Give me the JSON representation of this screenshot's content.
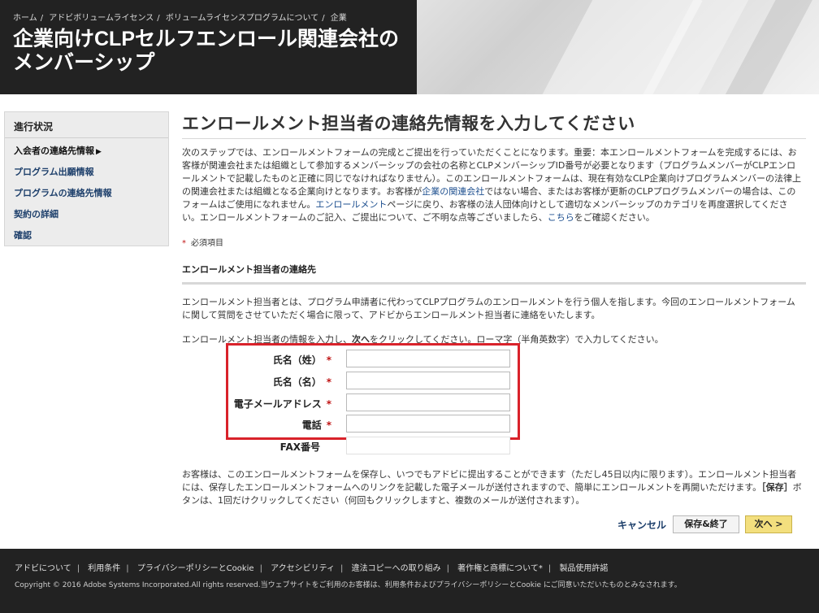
{
  "header": {
    "breadcrumb": [
      "ホーム",
      "アドビボリュームライセンス",
      "ボリュームライセンスプログラムについて",
      "企業"
    ],
    "breadcrumb_separator": "/",
    "title": "企業向けCLPセルフエンロール関連会社のメンバーシップ"
  },
  "sidebar": {
    "heading": "進行状況",
    "items": [
      {
        "label": "入会者の連絡先情報",
        "active": true
      },
      {
        "label": "プログラム出願情報",
        "active": false
      },
      {
        "label": "プログラムの連絡先情報",
        "active": false
      },
      {
        "label": "契約の詳細",
        "active": false
      },
      {
        "label": "確認",
        "active": false
      }
    ],
    "active_marker": "▶"
  },
  "main": {
    "title": "エンロールメント担当者の連絡先情報を入力してください",
    "intro": {
      "p1": "次のステップでは、エンロールメントフォームの完成とご提出を行っていただくことになります。重要：本エンロールメントフォームを完成するには、お客様が関連会社または組織として参加するメンバーシップの会社の名称とCLPメンバーシップID番号が必要となります（プログラムメンバーがCLPエンロールメントで記載したものと正確に同じでなければなりません）。このエンロールメントフォームは、現在有効なCLP企業向けプログラムメンバーの法律上の関連会社または組織となる企業向けとなります。お客様が",
      "link1": "企業の関連会社",
      "p2": "ではない場合、またはお客様が更新のCLPプログラムメンバーの場合は、このフォームはご使用になれません。",
      "link2": "エンロールメント",
      "p3": "ページに戻り、お客様の法人団体向けとして適切なメンバーシップのカテゴリを再度選択してください。エンロールメントフォームのご記入、ご提出について、ご不明な点等ございましたら、",
      "link3": "こちら",
      "p4": "をご確認ください。"
    },
    "required_star": "*",
    "required_note": "必須項目",
    "section_head": "エンロールメント担当者の連絡先",
    "para1": "エンロールメント担当者とは、プログラム申請者に代わってCLPプログラムのエンロールメントを行う個人を指します。今回のエンロールメントフォームに関して質問をさせていただく場合に限って、アドビからエンロールメント担当者に連絡をいたします。",
    "para2_a": "エンロールメント担当者の情報を入力し、",
    "para2_next": "次へ",
    "para2_b": "をクリックしてください。ローマ字（半角英数字）で入力してください。"
  },
  "form": {
    "fields": [
      {
        "label": "氏名（姓）",
        "required": "*",
        "value": ""
      },
      {
        "label": "氏名（名）",
        "required": "*",
        "value": ""
      },
      {
        "label": "電子メールアドレス",
        "required": "*",
        "value": ""
      },
      {
        "label": "電話",
        "required": "*",
        "value": ""
      },
      {
        "label": "FAX番号",
        "required": "",
        "value": ""
      }
    ]
  },
  "save_note": {
    "a": "お客様は、このエンロールメントフォームを保存し、いつでもアドビに提出することができます（ただし45日以内に限ります）。エンロールメント担当者には、保存したエンロールメントフォームへのリンクを記載した電子メールが送付されますので、簡単にエンロールメントを再開いただけます。",
    "bold": "［保存］",
    "b": "ボタンは、1回だけクリックしてください（何回もクリックしますと、複数のメールが送付されます）。"
  },
  "actions": {
    "cancel": "キャンセル",
    "save": "保存&終了",
    "next": "次へ >"
  },
  "footer": {
    "links": [
      "アドビについて",
      "利用条件",
      "プライバシーポリシーとCookie",
      "アクセシビリティ",
      "違法コピーへの取り組み",
      "著作権と商標について*",
      "製品使用許諾"
    ],
    "separator": "|",
    "copyright": "Copyright © 2016 Adobe Systems Incorporated.All rights reserved.当ウェブサイトをご利用のお客様は、利用条件およびプライバシーポリシーとCookie にご同意いただいたものとみなされます。"
  },
  "colors": {
    "header_dark": "#222222",
    "link": "#1d4f8f",
    "required": "#c01414",
    "highlight_box": "#d9222a",
    "next_button": "#f3df7e"
  }
}
